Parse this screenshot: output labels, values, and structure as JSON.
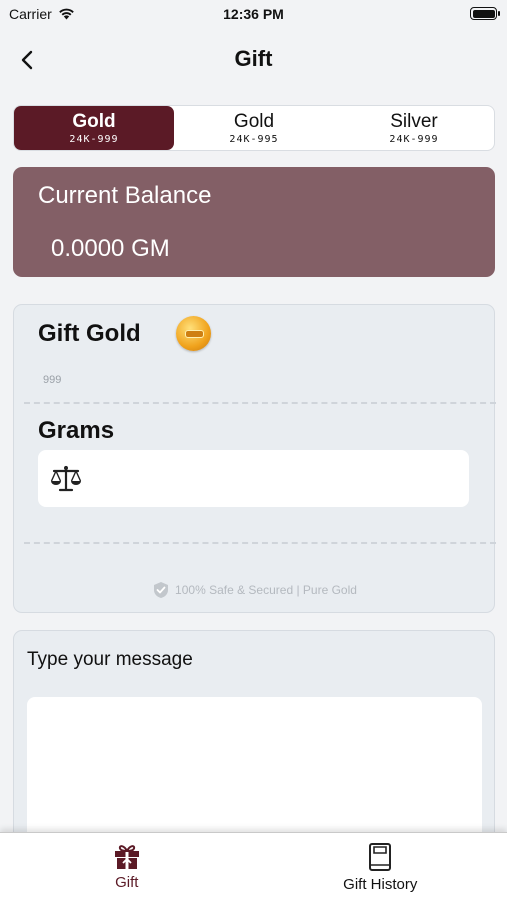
{
  "status": {
    "carrier": "Carrier",
    "time": "12:36 PM"
  },
  "nav": {
    "title": "Gift"
  },
  "metal_tabs": [
    {
      "title": "Gold",
      "sub": "24K-999",
      "active": true
    },
    {
      "title": "Gold",
      "sub": "24K-995",
      "active": false
    },
    {
      "title": "Silver",
      "sub": "24K-999",
      "active": false
    }
  ],
  "balance": {
    "label": "Current Balance",
    "value": "0.0000 GM"
  },
  "gift": {
    "title": "Gift Gold",
    "purity": "999",
    "grams_label": "Grams",
    "grams_value": "",
    "secure_text": "100% Safe & Secured | Pure Gold"
  },
  "message": {
    "label": "Type your message",
    "value": ""
  },
  "tabbar": {
    "gift_label": "Gift",
    "history_label": "Gift History"
  },
  "colors": {
    "brand": "#5b1a26",
    "balance_card": "#835f66"
  }
}
